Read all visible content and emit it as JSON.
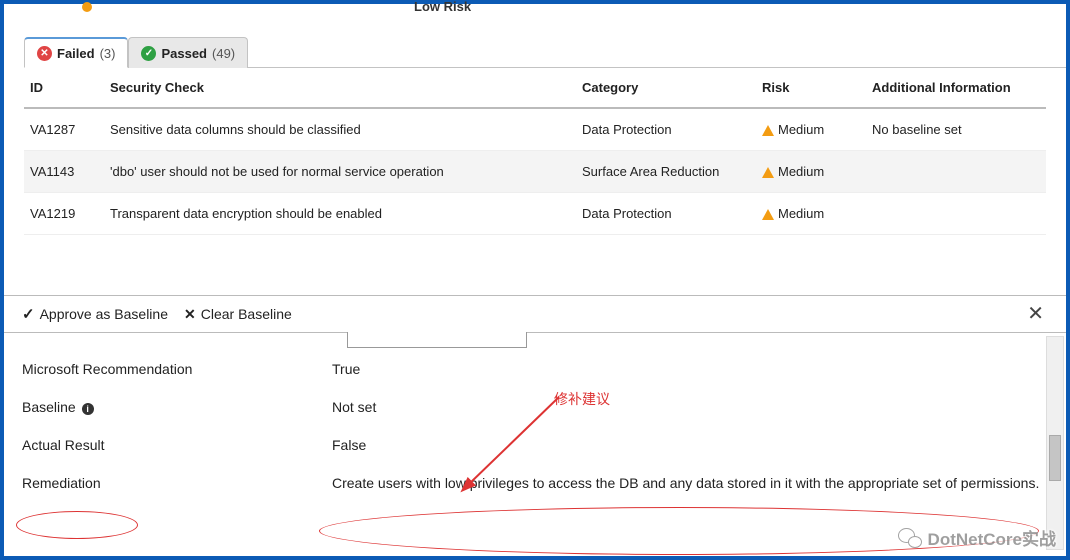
{
  "top_fragment": {
    "low_risk_label": "Low Risk"
  },
  "tabs": {
    "failed": {
      "label": "Failed",
      "count": "(3)"
    },
    "passed": {
      "label": "Passed",
      "count": "(49)"
    }
  },
  "columns": {
    "id": "ID",
    "check": "Security Check",
    "category": "Category",
    "risk": "Risk",
    "additional": "Additional Information"
  },
  "rows": [
    {
      "id": "VA1287",
      "check": "Sensitive data columns should be classified",
      "category": "Data Protection",
      "risk": "Medium",
      "additional": "No baseline set"
    },
    {
      "id": "VA1143",
      "check": "'dbo' user should not be used for normal service operation",
      "category": "Surface Area Reduction",
      "risk": "Medium",
      "additional": ""
    },
    {
      "id": "VA1219",
      "check": "Transparent data encryption should be enabled",
      "category": "Data Protection",
      "risk": "Medium",
      "additional": ""
    }
  ],
  "detail_header": {
    "approve": "Approve as Baseline",
    "clear": "Clear Baseline"
  },
  "details": {
    "ms_rec_label": "Microsoft Recommendation",
    "ms_rec_value": "True",
    "baseline_label": "Baseline",
    "baseline_value": "Not set",
    "actual_label": "Actual Result",
    "actual_value": "False",
    "remediation_label": "Remediation",
    "remediation_value": "Create users with low privileges to access the DB and any data stored in it with the appropriate set of permissions."
  },
  "annotations": {
    "cn_text": "修补建议"
  },
  "watermark": "DotNetCore实战"
}
